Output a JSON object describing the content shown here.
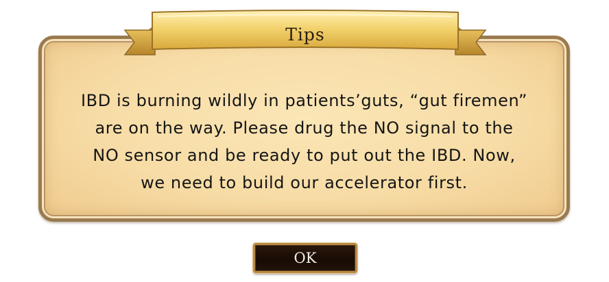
{
  "dialog": {
    "title": "Tips",
    "message_lines": [
      "IBD is burning wildly in patients’guts, “gut firemen”",
      "are on the way. Please drug the NO signal to the",
      "NO sensor and be ready to put out the IBD. Now,",
      "we need to build our accelerator first."
    ],
    "ok_label": "OK"
  },
  "colors": {
    "parchment": "#f7dca6",
    "panel_border": "#9a7a4e",
    "ribbon_gold": "#f0cf6a",
    "button_dark": "#1c0f06",
    "button_border": "#b98a45"
  }
}
